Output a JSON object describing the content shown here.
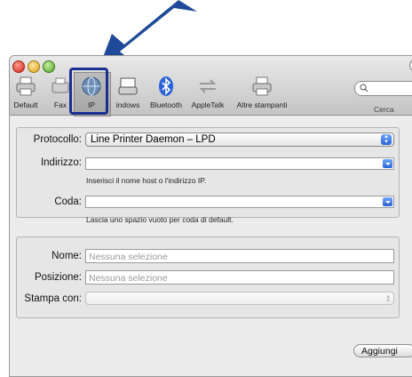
{
  "toolbar": {
    "items": [
      {
        "label": "Default",
        "icon": "printer-icon"
      },
      {
        "label": "Fax",
        "icon": "fax-icon"
      },
      {
        "label": "IP",
        "icon": "globe-icon"
      },
      {
        "label": "indows",
        "icon": "windows-printer-icon"
      },
      {
        "label": "Bluetooth",
        "icon": "bluetooth-icon"
      },
      {
        "label": "AppleTalk",
        "icon": "appletalk-icon"
      },
      {
        "label": "Altre stampanti",
        "icon": "printer-icon"
      }
    ],
    "search_label": "Cerca"
  },
  "form": {
    "protocol_label": "Protocollo:",
    "protocol_value": "Line Printer Daemon – LPD",
    "address_label": "Indirizzo:",
    "address_value": "",
    "address_hint": "Inserisci il nome host o l'indirizzo IP.",
    "queue_label": "Coda:",
    "queue_value": "",
    "queue_hint": "Lascia uno spazio vuoto per coda di default."
  },
  "details": {
    "name_label": "Nome:",
    "name_placeholder": "Nessuna selezione",
    "location_label": "Posizione:",
    "location_placeholder": "Nessuna selezione",
    "print_with_label": "Stampa con:"
  },
  "buttons": {
    "add": "Aggiungi"
  },
  "colors": {
    "highlight_border": "#1a2f8f",
    "arrow": "#1f4a99",
    "accent": "#2a62d8"
  }
}
